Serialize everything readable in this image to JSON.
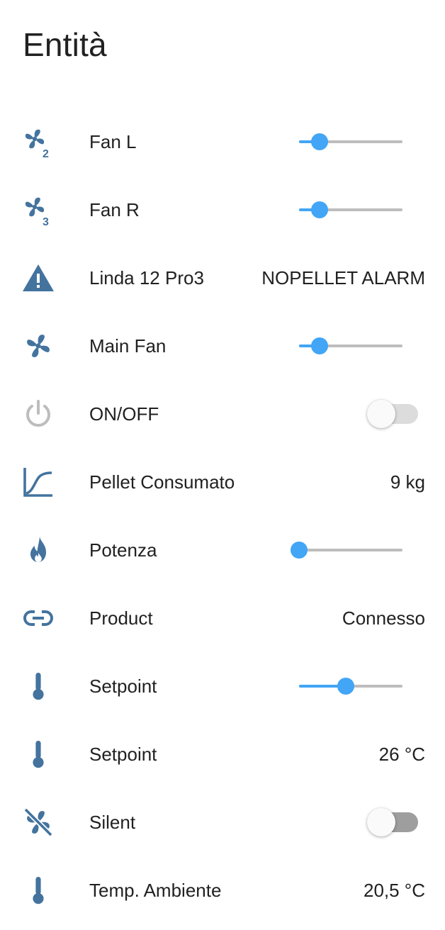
{
  "page": {
    "title": "Entità"
  },
  "colors": {
    "icon": "#44739e",
    "icon_off": "#bdbdbd",
    "accent": "#42a5f5",
    "text": "#212121"
  },
  "entities": [
    {
      "icon": "fan-speed-2-icon",
      "label": "Fan L",
      "control": "slider",
      "level": 0.2
    },
    {
      "icon": "fan-speed-3-icon",
      "label": "Fan R",
      "control": "slider",
      "level": 0.2
    },
    {
      "icon": "alert-icon",
      "label": "Linda 12 Pro3",
      "control": "text",
      "value": "NOPELLET ALARM"
    },
    {
      "icon": "fan-icon",
      "label": "Main Fan",
      "control": "slider",
      "level": 0.2
    },
    {
      "icon": "power-icon",
      "label": "ON/OFF",
      "control": "toggle",
      "state": "off"
    },
    {
      "icon": "chart-curve-icon",
      "label": "Pellet Consumato",
      "control": "text",
      "value": "9 kg"
    },
    {
      "icon": "fire-icon",
      "label": "Potenza",
      "control": "slider",
      "level": 0.0
    },
    {
      "icon": "link-icon",
      "label": "Product",
      "control": "text",
      "value": "Connesso"
    },
    {
      "icon": "thermometer-icon",
      "label": "Setpoint",
      "control": "slider",
      "level": 0.45
    },
    {
      "icon": "thermometer-icon",
      "label": "Setpoint",
      "control": "text",
      "value": "26 °C"
    },
    {
      "icon": "fan-off-icon",
      "label": "Silent",
      "control": "toggle",
      "state": "off"
    },
    {
      "icon": "thermometer-icon",
      "label": "Temp. Ambiente",
      "control": "text",
      "value": "20,5 °C"
    }
  ]
}
